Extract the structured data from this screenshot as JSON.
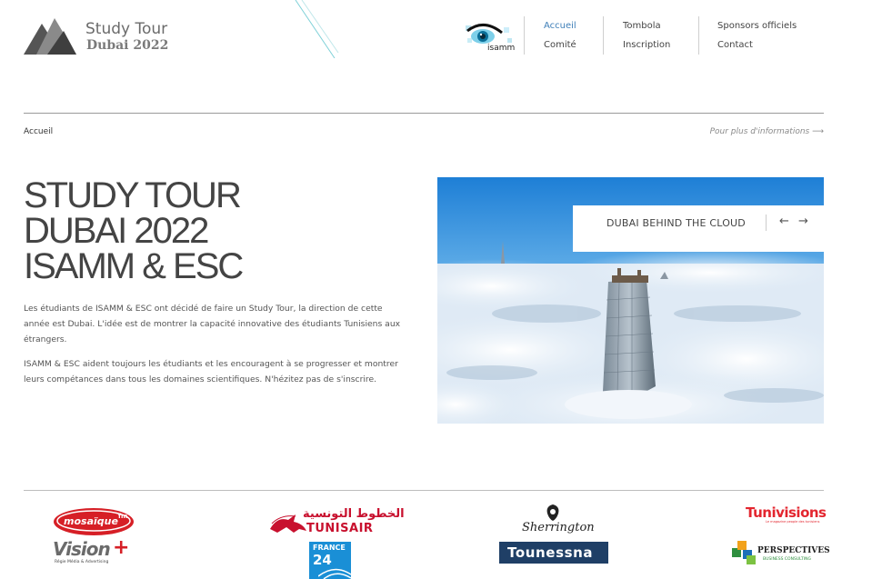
{
  "brand": {
    "title": "Study Tour",
    "subtitle": "Dubai 2022"
  },
  "partner_logo": {
    "label": "isamm"
  },
  "nav": {
    "col1": [
      "Accueil",
      "Comité"
    ],
    "col2": [
      "Tombola",
      "Inscription"
    ],
    "col3": [
      "Sponsors officiels",
      "Contact"
    ],
    "active": "Accueil"
  },
  "breadcrumb": {
    "current": "Accueil",
    "more_info": "Pour plus d'informations ⟶"
  },
  "hero": {
    "title_lines": [
      "STUDY TOUR",
      "DUBAI 2022",
      "ISAMM & ESC"
    ],
    "paragraph1": "Les étudiants de ISAMM & ESC ont décidé de faire un Study Tour, la direction de cette année est Dubai. L'idée est de montrer la capacité innovative des étudiants Tunisiens aux étrangers.",
    "paragraph2": "ISAMM & ESC aident toujours les étudiants et les encouragent à se progresser et montrer leurs compétances dans tous les domaines scientifiques. N'hézitez pas de s'inscrire."
  },
  "slider": {
    "caption": "DUBAI BEHIND THE CLOUD",
    "prev": "←",
    "next": "→"
  },
  "sponsors": {
    "mosaique": "mosaïque",
    "mosaique_fm": "fm",
    "vision": "Vision",
    "vision_plus": "+",
    "vision_tag": "Régie Média & Advertising",
    "tunisair_ar": "الخطوط التونسية",
    "tunisair": "TUNISAIR",
    "france24_a": "FRANCE",
    "france24_b": "24",
    "sherrington": "Sherrington",
    "tounessna": "Tounessna",
    "tunivisions": "Tunivisions",
    "tunivisions_tag": "Le magazine people des tunisiens",
    "perspectives": "PERSPECTIVES",
    "perspectives_tag": "BUSINESS CONSULTING"
  },
  "colors": {
    "nav_active": "#3f7fb8",
    "mosaique_red": "#d61f26",
    "tunisair_red": "#c8102e",
    "france24_blue": "#1a8fd6",
    "tounessna_navy": "#1f3f66",
    "tunivisions_red": "#e3262f"
  }
}
